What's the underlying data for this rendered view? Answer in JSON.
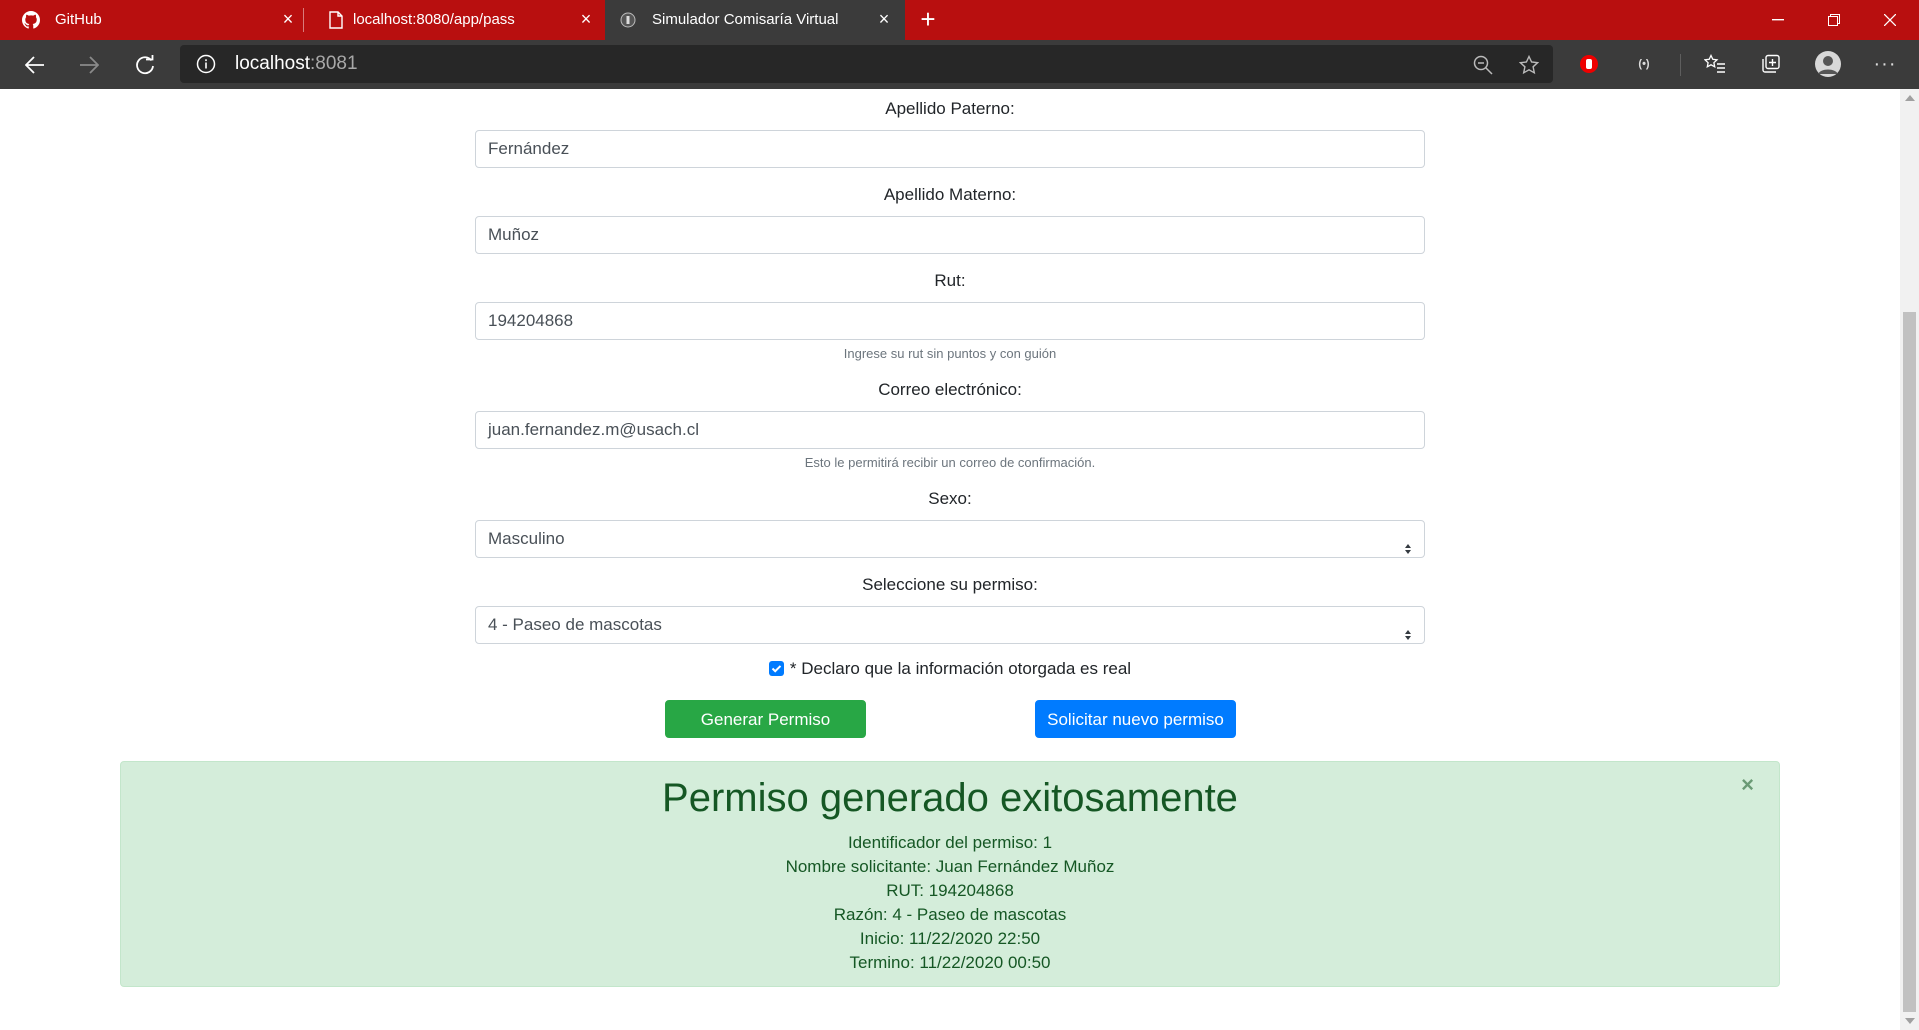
{
  "browser": {
    "tabs": [
      {
        "label": "GitHub",
        "icon": "github-icon"
      },
      {
        "label": "localhost:8080/app/pass",
        "icon": "page-icon"
      },
      {
        "label": "Simulador Comisaría Virtual",
        "icon": "site-icon"
      }
    ],
    "url_host": "localhost",
    "url_port": ":8081"
  },
  "form": {
    "apellido_paterno_label": "Apellido Paterno:",
    "apellido_paterno_value": "Fernández",
    "apellido_materno_label": "Apellido Materno:",
    "apellido_materno_value": "Muñoz",
    "rut_label": "Rut:",
    "rut_value": "194204868",
    "rut_help": "Ingrese su rut sin puntos y con guión",
    "email_label": "Correo electrónico:",
    "email_value": "juan.fernandez.m@usach.cl",
    "email_help": "Esto le permitirá recibir un correo de confirmación.",
    "sexo_label": "Sexo:",
    "sexo_value": "Masculino",
    "permiso_label": "Seleccione su permiso:",
    "permiso_value": "4 - Paseo de mascotas",
    "declaracion_label": "* Declaro que la información otorgada es real",
    "declaracion_checked": true,
    "generar_button": "Generar Permiso",
    "nuevo_button": "Solicitar nuevo permiso"
  },
  "alert": {
    "title": "Permiso generado exitosamente",
    "close": "×",
    "lines": [
      "Identificador del permiso: 1",
      "Nombre solicitante: Juan Fernández Muñoz",
      "RUT: 194204868",
      "Razón: 4 - Paseo de mascotas",
      "Inicio: 11/22/2020 22:50",
      "Termino: 11/22/2020 00:50"
    ]
  },
  "colors": {
    "tabbar": "#b80f0f",
    "toolbar": "#3b3b3b",
    "success": "#28a745",
    "primary": "#007bff",
    "alert_bg": "#d4edda",
    "alert_text": "#155724"
  }
}
